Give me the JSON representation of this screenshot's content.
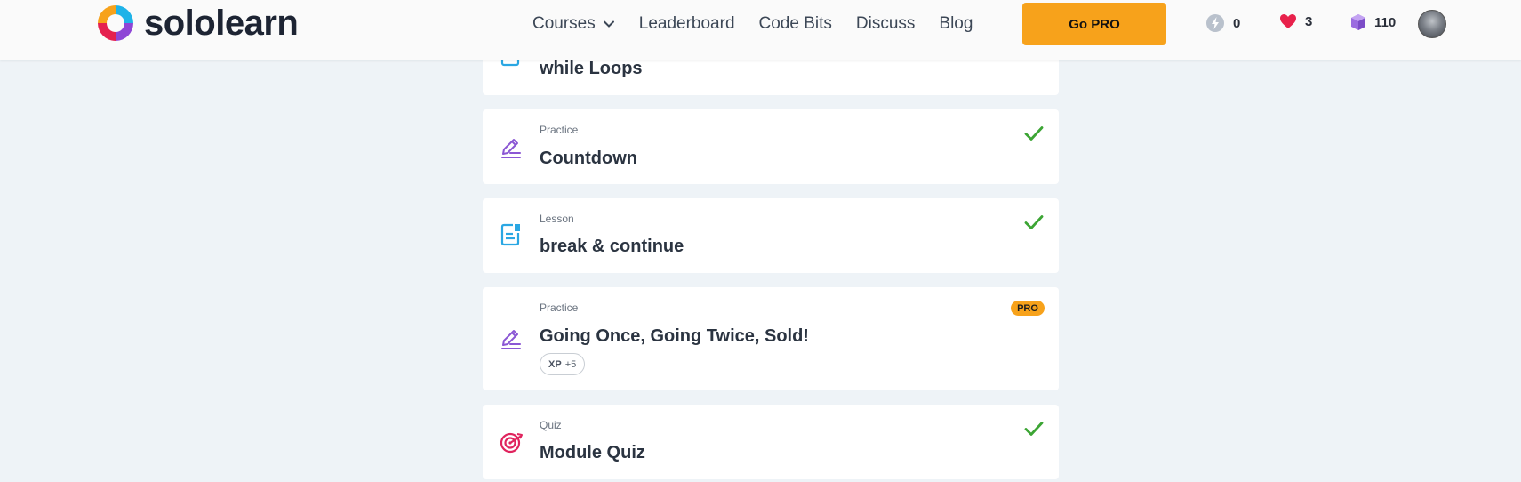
{
  "brand": {
    "name": "sololearn"
  },
  "nav": {
    "links": [
      "Courses",
      "Leaderboard",
      "Code Bits",
      "Discuss",
      "Blog"
    ],
    "gopro_label": "Go PRO"
  },
  "stats": {
    "streak": "0",
    "hearts": "3",
    "bits": "110"
  },
  "items": [
    {
      "type": "",
      "title": "while Loops",
      "icon": "lesson-icon",
      "completed": false
    },
    {
      "type": "Practice",
      "title": "Countdown",
      "icon": "pencil-practice-icon",
      "completed": true
    },
    {
      "type": "Lesson",
      "title": "break & continue",
      "icon": "lesson-icon",
      "completed": true
    },
    {
      "type": "Practice",
      "title": "Going Once, Going Twice, Sold!",
      "icon": "pencil-practice-icon",
      "completed": false,
      "badge": "PRO",
      "xp_label": "XP",
      "xp_value": "+5"
    },
    {
      "type": "Quiz",
      "title": "Module Quiz",
      "icon": "target-quiz-icon",
      "completed": true
    }
  ],
  "colors": {
    "accent_orange": "#f7a21b",
    "check_green": "#3ca534",
    "lesson_blue": "#2aa7e3",
    "practice_purple": "#8b57d4",
    "quiz_pink": "#e0245e",
    "heart_red": "#e8214b",
    "bit_purple": "#9b6ce0"
  }
}
